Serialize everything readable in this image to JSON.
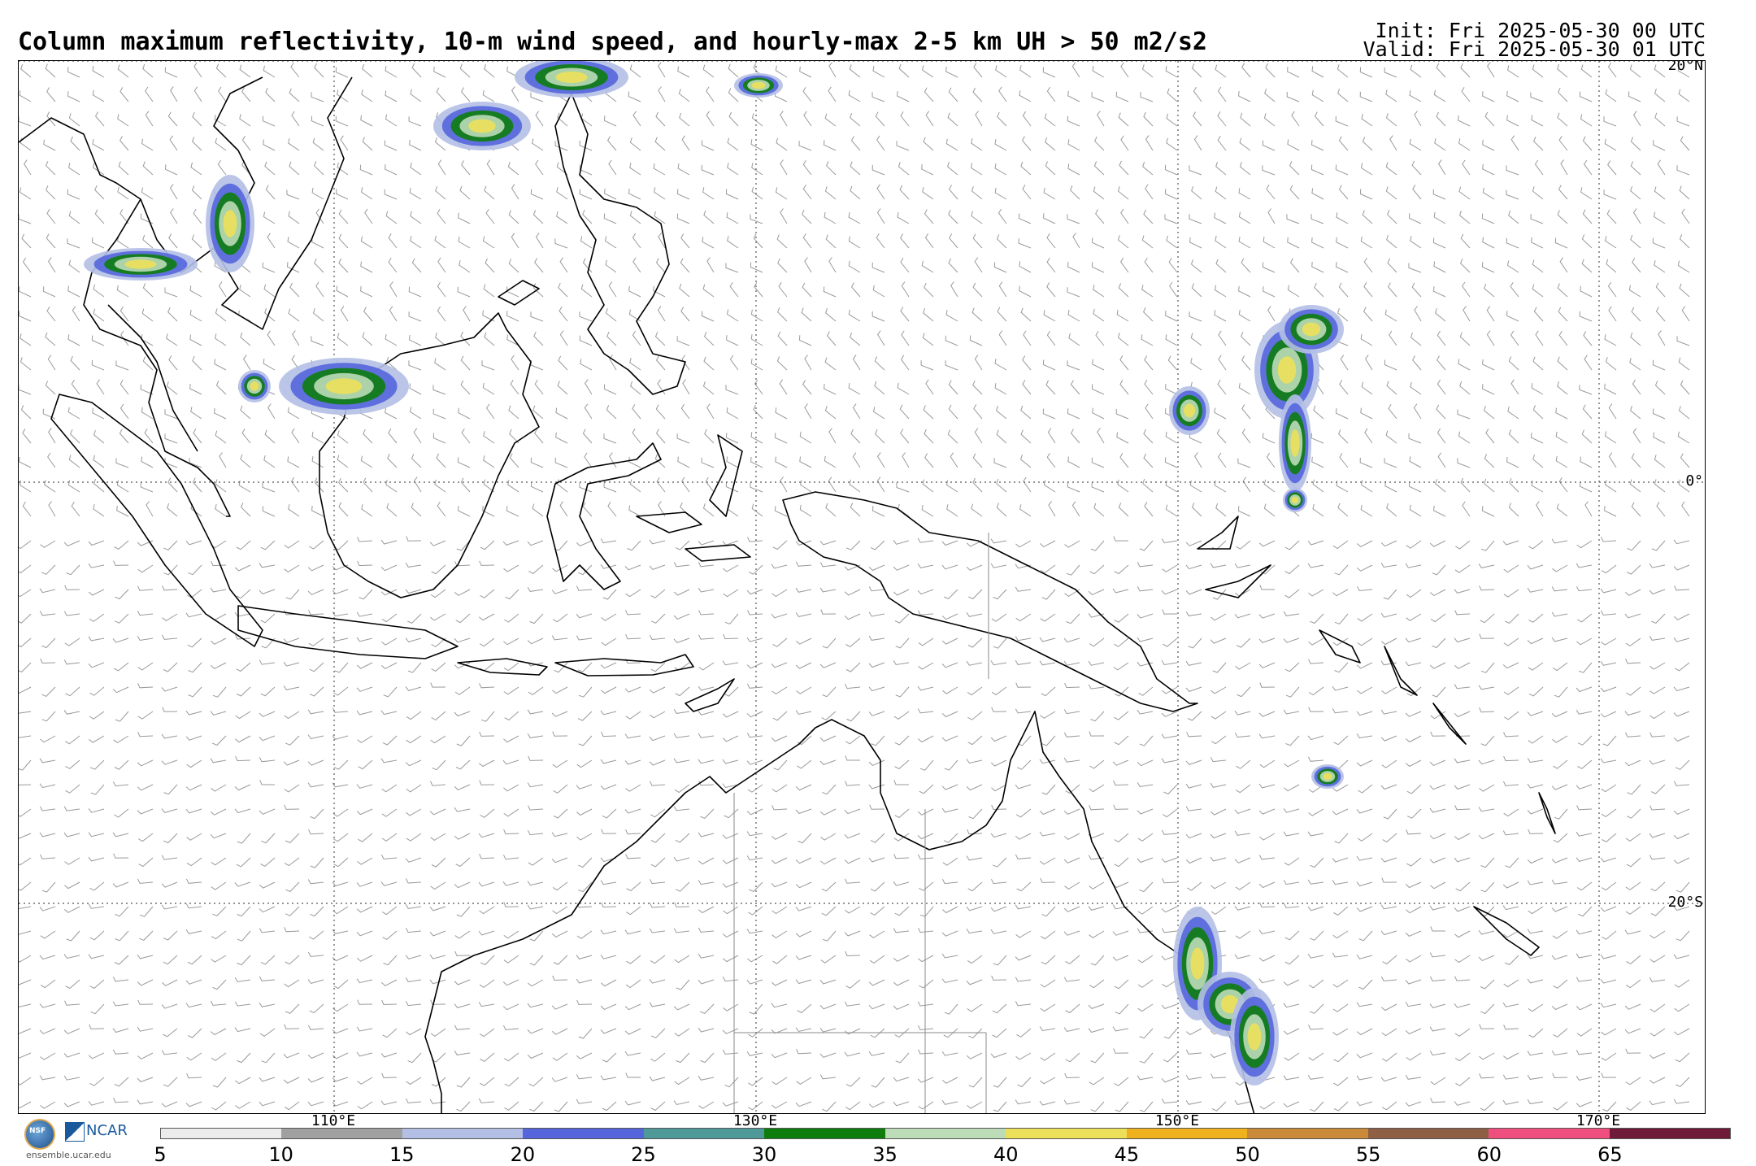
{
  "header": {
    "title": "Column maximum reflectivity, 10-m wind speed, and hourly-max 2-5 km UH > 50 m2/s2",
    "init": "Init: Fri 2025-05-30 00 UTC",
    "valid": "Valid: Fri 2025-05-30 01 UTC"
  },
  "map": {
    "lat_labels": [
      "20°N",
      "0°",
      "20°S"
    ],
    "lon_labels": [
      "110°E",
      "130°E",
      "150°E",
      "170°E"
    ]
  },
  "colorbar": {
    "ticks": [
      "5",
      "10",
      "15",
      "20",
      "25",
      "30",
      "35",
      "40",
      "45",
      "50",
      "55",
      "60",
      "65"
    ],
    "colors": [
      "#ececec",
      "#a0a0a0",
      "#b4bfe6",
      "#5566dd",
      "#4f9a98",
      "#0e7d0e",
      "#bcdcb8",
      "#ece05a",
      "#efb11d",
      "#c98a3a",
      "#8f5f45",
      "#ef4f7f",
      "#6e1a38"
    ]
  },
  "logos": {
    "nsf": "NSF",
    "ncar": "NCAR",
    "url": "ensemble.ucar.edu"
  }
}
